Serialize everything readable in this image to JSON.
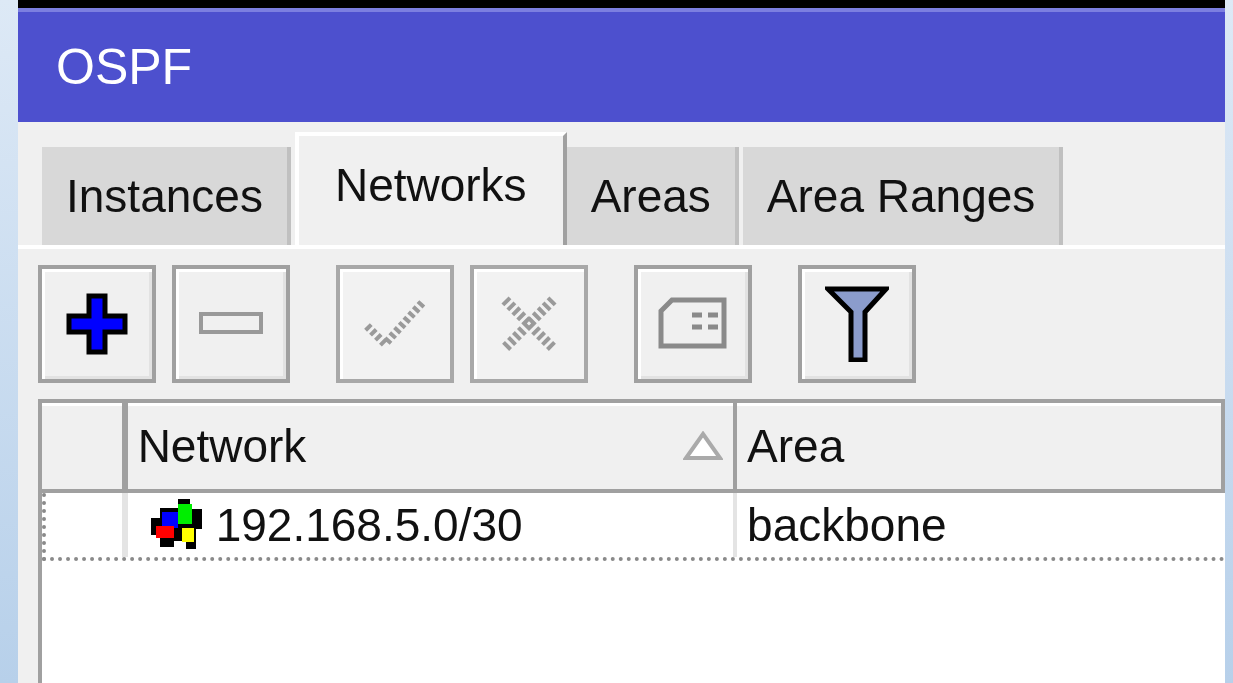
{
  "window": {
    "title": "OSPF"
  },
  "tabs": [
    {
      "label": "Instances",
      "selected": false
    },
    {
      "label": "Networks",
      "selected": true
    },
    {
      "label": "Areas",
      "selected": false
    },
    {
      "label": "Area Ranges",
      "selected": false
    }
  ],
  "toolbar": [
    {
      "kind": "add",
      "disabled": false
    },
    {
      "kind": "remove",
      "disabled": false
    },
    {
      "kind": "enable",
      "disabled": true
    },
    {
      "kind": "disable",
      "disabled": true
    },
    {
      "kind": "comment",
      "disabled": false
    },
    {
      "kind": "filter",
      "disabled": false
    }
  ],
  "table": {
    "columns": [
      {
        "label": "Network",
        "sorted": true
      },
      {
        "label": "Area",
        "sorted": false
      }
    ],
    "rows": [
      {
        "network": "192.168.5.0/30",
        "area": "backbone",
        "focused": true
      }
    ]
  }
}
